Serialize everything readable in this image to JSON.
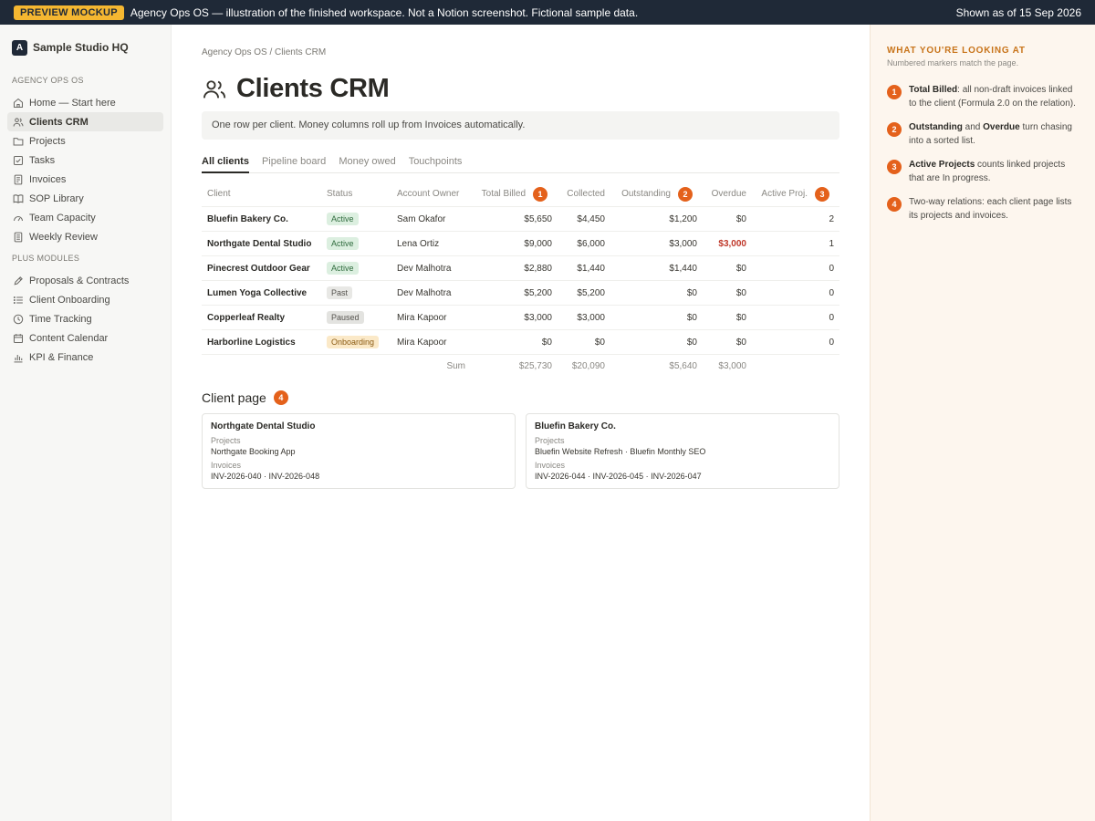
{
  "banner": {
    "tag": "PREVIEW MOCKUP",
    "note": "Agency Ops OS — illustration of the finished workspace. Not a Notion screenshot. Fictional sample data.",
    "date": "Shown as of 15 Sep 2026"
  },
  "sidebar": {
    "workspace_initial": "A",
    "workspace_name": "Sample Studio HQ",
    "section1": "AGENCY OPS OS",
    "items1": [
      {
        "label": "Home — Start here",
        "icon": "home-icon"
      },
      {
        "label": "Clients CRM",
        "icon": "people-icon",
        "active": true
      },
      {
        "label": "Projects",
        "icon": "folder-icon"
      },
      {
        "label": "Tasks",
        "icon": "checkbox-icon"
      },
      {
        "label": "Invoices",
        "icon": "document-icon"
      },
      {
        "label": "SOP Library",
        "icon": "book-icon"
      },
      {
        "label": "Team Capacity",
        "icon": "gauge-icon"
      },
      {
        "label": "Weekly Review",
        "icon": "list-doc-icon"
      }
    ],
    "section2": "PLUS MODULES",
    "items2": [
      {
        "label": "Proposals & Contracts",
        "icon": "pencil-icon"
      },
      {
        "label": "Client Onboarding",
        "icon": "list-icon"
      },
      {
        "label": "Time Tracking",
        "icon": "clock-icon"
      },
      {
        "label": "Content Calendar",
        "icon": "calendar-icon"
      },
      {
        "label": "KPI & Finance",
        "icon": "bar-chart-icon"
      }
    ]
  },
  "main": {
    "breadcrumb": "Agency Ops OS / Clients CRM",
    "title": "Clients CRM",
    "callout": "One row per client. Money columns roll up from Invoices automatically.",
    "tabs": [
      "All clients",
      "Pipeline board",
      "Money owed",
      "Touchpoints"
    ],
    "headers": {
      "client": "Client",
      "status": "Status",
      "owner": "Account Owner",
      "billed": "Total Billed",
      "billed_marker": "1",
      "collected": "Collected",
      "outstanding": "Outstanding",
      "outstanding_marker": "2",
      "overdue": "Overdue",
      "active": "Active Proj.",
      "active_marker": "3"
    },
    "rows": [
      {
        "client": "Bluefin Bakery Co.",
        "status": "Active",
        "owner": "Sam Okafor",
        "billed": "$5,650",
        "collected": "$4,450",
        "outstanding": "$1,200",
        "overdue": "$0",
        "active": "2"
      },
      {
        "client": "Northgate Dental Studio",
        "status": "Active",
        "owner": "Lena Ortiz",
        "billed": "$9,000",
        "collected": "$6,000",
        "outstanding": "$3,000",
        "overdue": "$3,000",
        "active": "1"
      },
      {
        "client": "Pinecrest Outdoor Gear",
        "status": "Active",
        "owner": "Dev Malhotra",
        "billed": "$2,880",
        "collected": "$1,440",
        "outstanding": "$1,440",
        "overdue": "$0",
        "active": "0"
      },
      {
        "client": "Lumen Yoga Collective",
        "status": "Past",
        "owner": "Dev Malhotra",
        "billed": "$5,200",
        "collected": "$5,200",
        "outstanding": "$0",
        "overdue": "$0",
        "active": "0"
      },
      {
        "client": "Copperleaf Realty",
        "status": "Paused",
        "owner": "Mira Kapoor",
        "billed": "$3,000",
        "collected": "$3,000",
        "outstanding": "$0",
        "overdue": "$0",
        "active": "0"
      },
      {
        "client": "Harborline Logistics",
        "status": "Onboarding",
        "owner": "Mira Kapoor",
        "billed": "$0",
        "collected": "$0",
        "outstanding": "$0",
        "overdue": "$0",
        "active": "0"
      }
    ],
    "status_colors": {
      "Active": {
        "bg": "#dcefe0",
        "fg": "#2f6b3d"
      },
      "Past": {
        "bg": "#e8e8e5",
        "fg": "#55534e"
      },
      "Paused": {
        "bg": "#e3e3e0",
        "fg": "#55534e"
      },
      "Onboarding": {
        "bg": "#fbe9c8",
        "fg": "#8a5a12"
      }
    },
    "overdue_color": "#c0392b",
    "sum": {
      "label": "Sum",
      "billed": "$25,730",
      "collected": "$20,090",
      "outstanding": "$5,640",
      "overdue": "$3,000"
    },
    "client_page_title": "Client page",
    "client_page_marker": "4",
    "cards": [
      {
        "name": "Northgate Dental Studio",
        "projects_label": "Projects",
        "projects": "Northgate Booking App",
        "invoices_label": "Invoices",
        "invoices": "INV-2026-040 · INV-2026-048"
      },
      {
        "name": "Bluefin Bakery Co.",
        "projects_label": "Projects",
        "projects": "Bluefin Website Refresh · Bluefin Monthly SEO",
        "invoices_label": "Invoices",
        "invoices": "INV-2026-044 · INV-2026-045 · INV-2026-047"
      }
    ]
  },
  "panel": {
    "heading": "WHAT YOU'RE LOOKING AT",
    "subheading": "Numbered markers match the page.",
    "accent": "#e4611b",
    "items": [
      {
        "n": "1",
        "bold": "Total Billed",
        "text": ": all non-draft invoices linked to the client (Formula 2.0 on the relation)."
      },
      {
        "n": "2",
        "bold": "Outstanding",
        "mid": " and ",
        "bold2": "Overdue",
        "text": " turn chasing into a sorted list."
      },
      {
        "n": "3",
        "bold": "Active Projects",
        "text": " counts linked projects that are In progress."
      },
      {
        "n": "4",
        "bold": "",
        "text": "Two-way relations: each client page lists its projects and invoices."
      }
    ]
  }
}
